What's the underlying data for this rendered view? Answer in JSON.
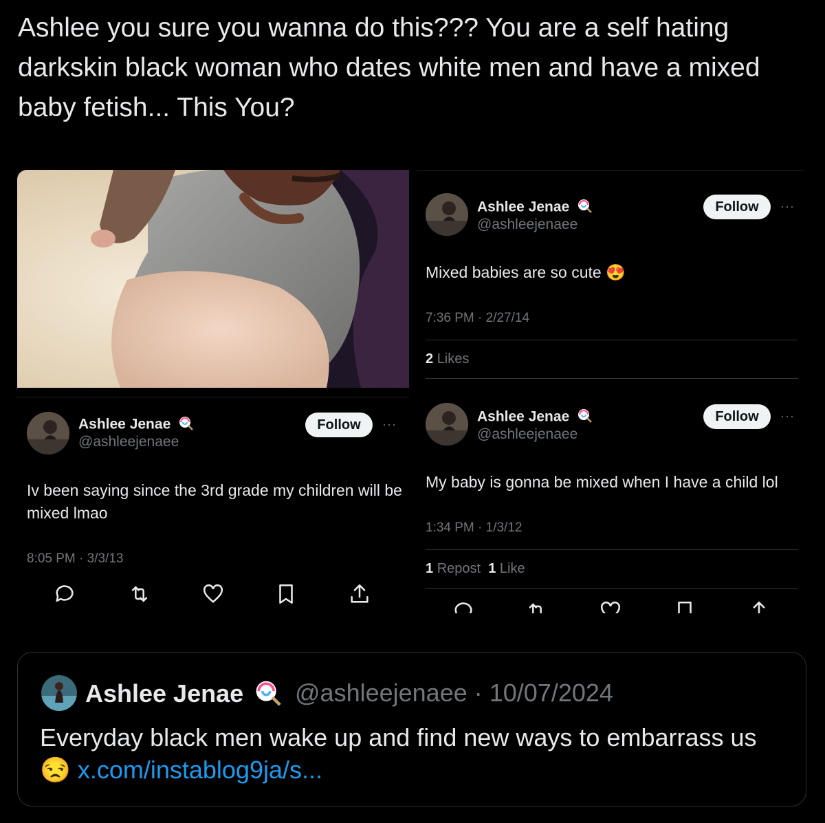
{
  "main_tweet": {
    "text": "Ashlee you sure you wanna do this??? You are a self hating darkskin black woman who dates white men and have a mixed baby fetish... This You?"
  },
  "screenshots": [
    {
      "name": "Ashlee Jenae",
      "handle": "@ashleejenaee",
      "follow_label": "Follow",
      "more": "···",
      "text": "Iv been saying since the 3rd grade my children will be mixed lmao",
      "timestamp": "8:05 PM · 3/3/13"
    },
    {
      "name": "Ashlee Jenae",
      "handle": "@ashleejenaee",
      "follow_label": "Follow",
      "more": "···",
      "text": "Mixed babies are so cute",
      "emoji": "😍",
      "timestamp": "7:36 PM · 2/27/14",
      "likes_count": "2",
      "likes_label": "Likes"
    },
    {
      "name": "Ashlee Jenae",
      "handle": "@ashleejenaee",
      "follow_label": "Follow",
      "more": "···",
      "text": "My baby is gonna be mixed when I have a child lol",
      "timestamp": "1:34 PM · 1/3/12",
      "reposts_count": "1",
      "reposts_label": "Repost",
      "likes_count": "1",
      "likes_label": "Like"
    }
  ],
  "quoted_tweet": {
    "name": "Ashlee Jenae",
    "handle_date": "@ashleejenaee · 10/07/2024",
    "text": "Everyday black men wake up and find new ways to embarrass us",
    "emoji": "😒",
    "link": "x.com/instablog9ja/s..."
  },
  "icons": [
    "lollipop-icon",
    "reply-icon",
    "repost-icon",
    "like-icon",
    "bookmark-icon",
    "share-icon",
    "more-icon"
  ],
  "colors": {
    "background": "#000000",
    "text": "#e7e9ea",
    "muted": "#71767b",
    "link": "#1d9bf0",
    "follow_bg": "#eff3f4"
  }
}
